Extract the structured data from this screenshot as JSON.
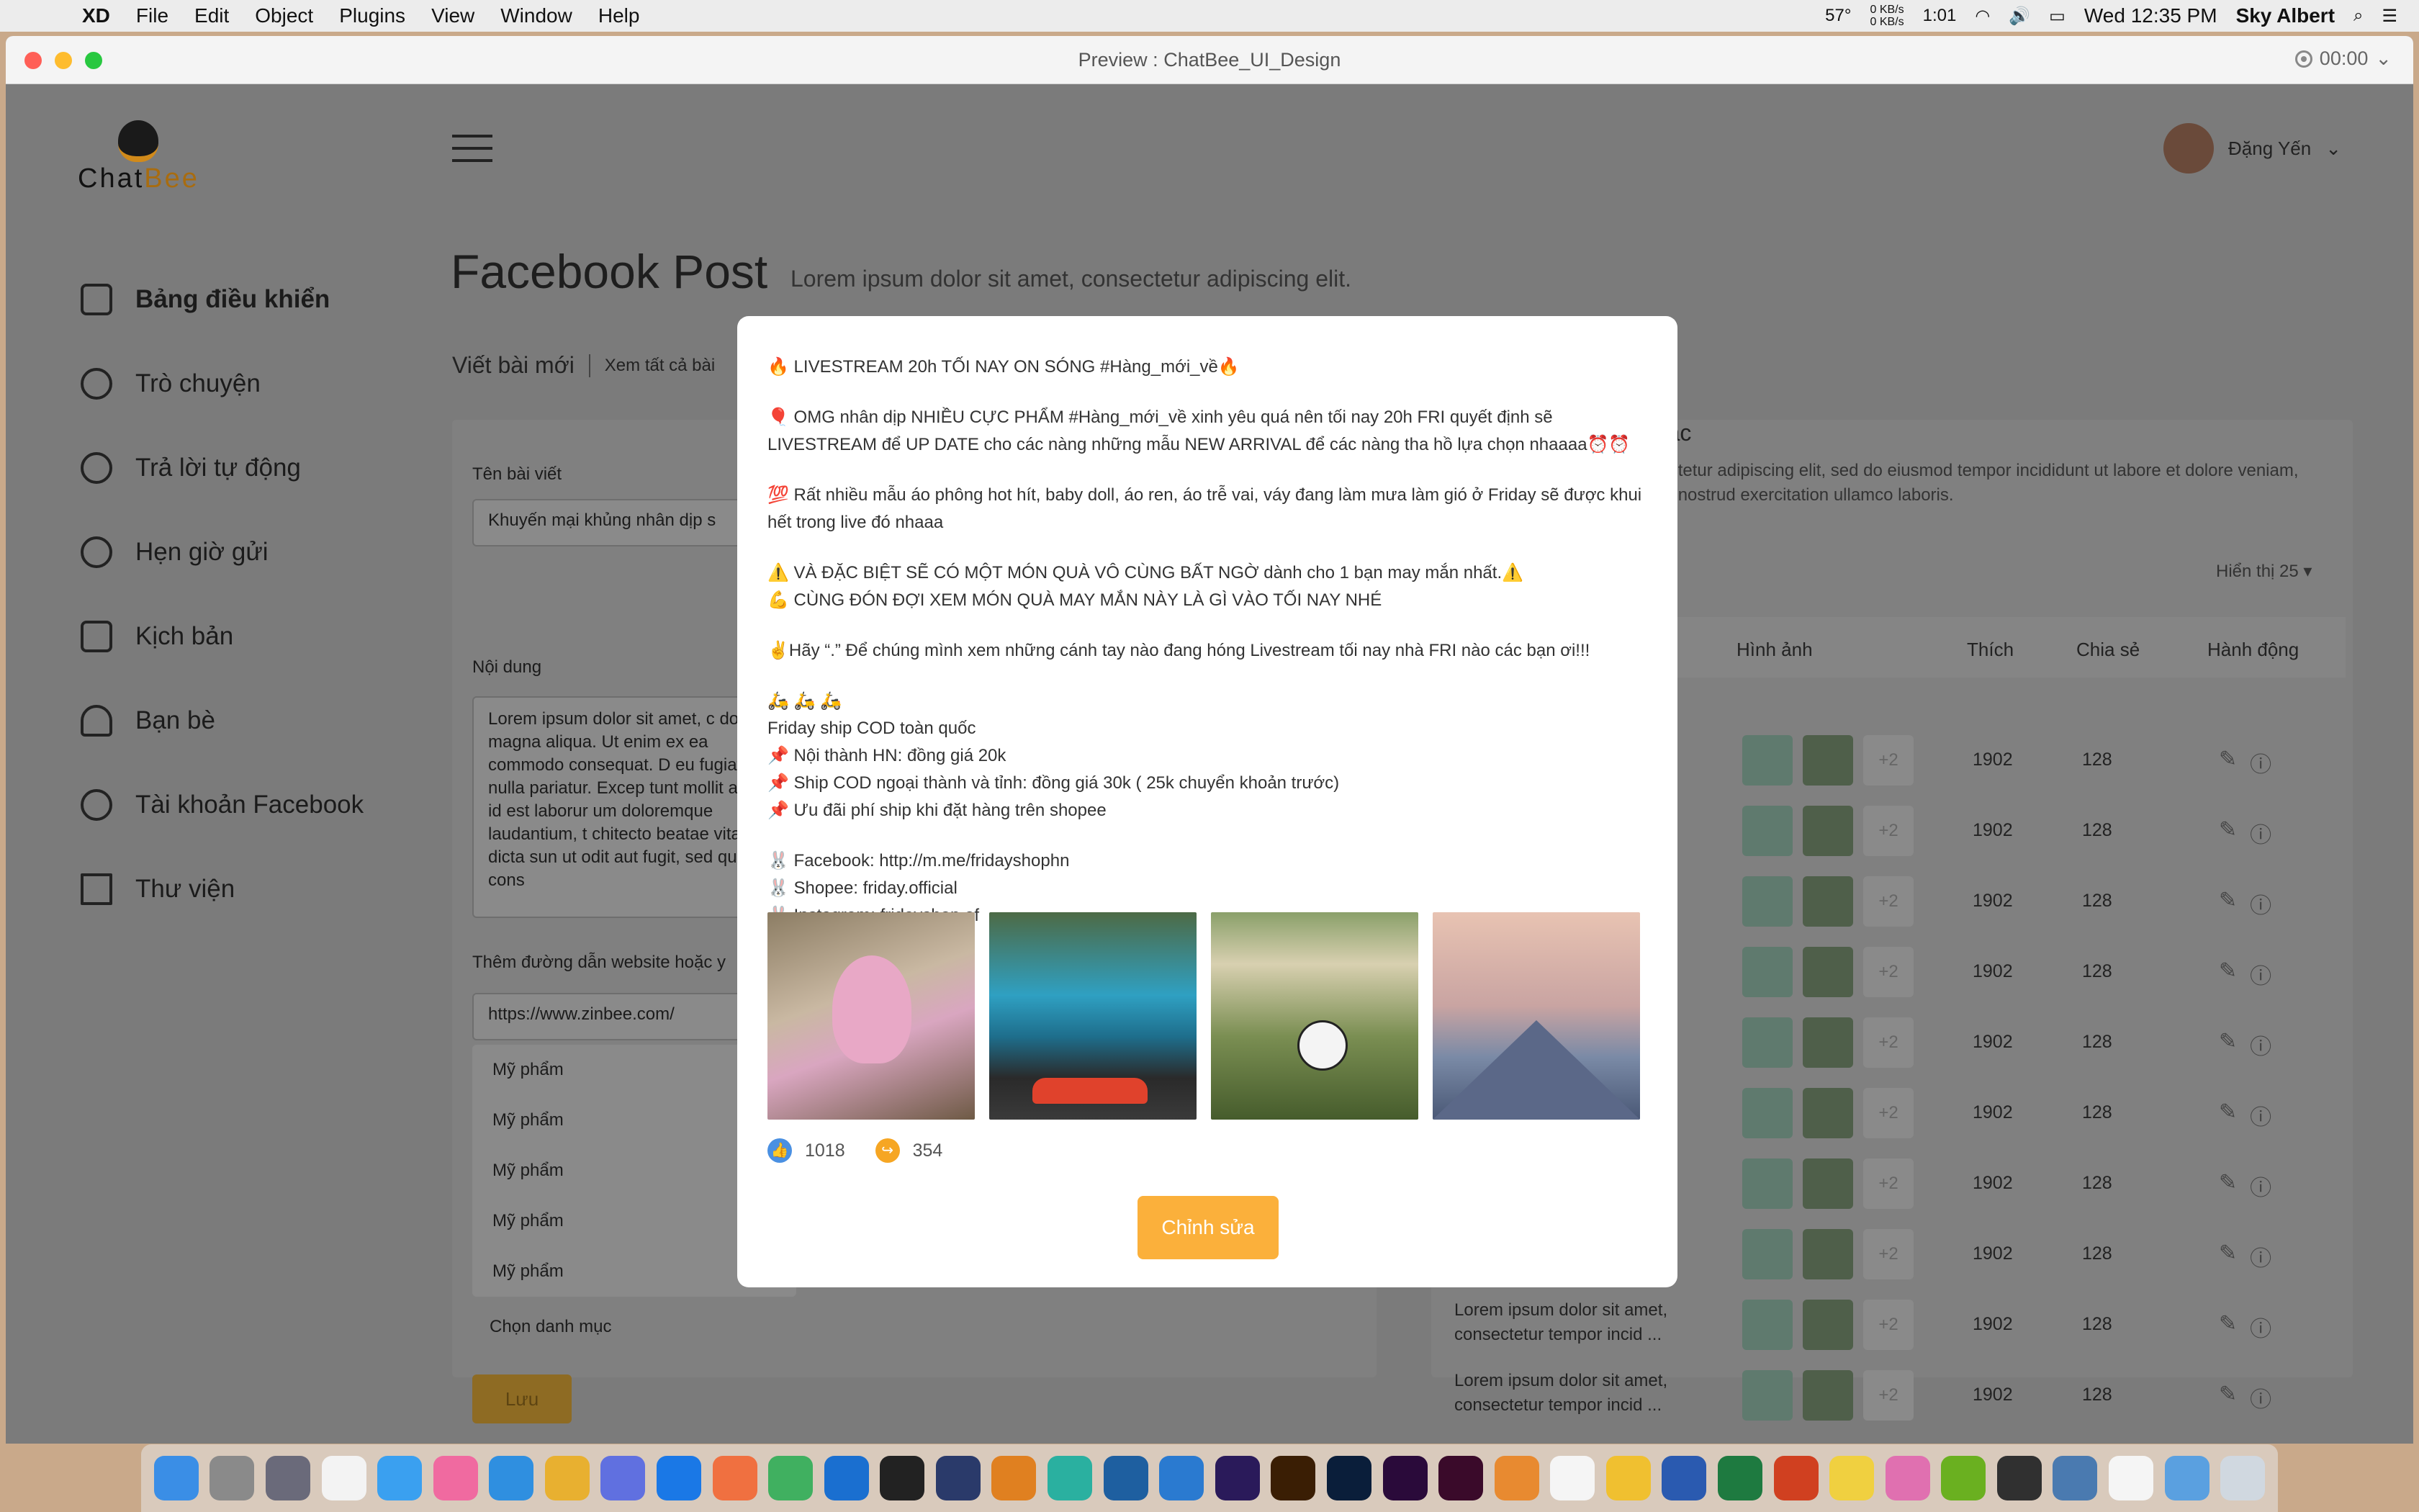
{
  "menubar": {
    "app": "XD",
    "items": [
      "File",
      "Edit",
      "Object",
      "Plugins",
      "View",
      "Window",
      "Help"
    ],
    "temperature": "57°",
    "net_up": "0 KB/s",
    "net_down": "0 KB/s",
    "battery_time": "1:01",
    "clock": "Wed 12:35 PM",
    "user": "Sky Albert"
  },
  "window": {
    "title": "Preview : ChatBee_UI_Design",
    "timer": "00:00"
  },
  "app": {
    "logo": {
      "chat": "Chat",
      "bee": "Bee"
    },
    "sidebar": [
      {
        "label": "Bảng điều khiển",
        "icon": "home-icon"
      },
      {
        "label": "Trò chuyện",
        "icon": "chat-icon"
      },
      {
        "label": "Trả lời tự động",
        "icon": "auto-reply-icon"
      },
      {
        "label": "Hẹn giờ gửi",
        "icon": "clock-icon"
      },
      {
        "label": "Kịch bản",
        "icon": "document-icon"
      },
      {
        "label": "Bạn bè",
        "icon": "friends-icon"
      },
      {
        "label": "Tài khoản Facebook",
        "icon": "account-icon"
      },
      {
        "label": "Thư viện",
        "icon": "library-icon"
      }
    ],
    "user_name": "Đặng Yến",
    "page_title": "Facebook Post",
    "page_subtitle": "Lorem ipsum dolor sit amet, consectetur adipiscing elit.",
    "tabs": {
      "new_post": "Viết bài mới",
      "view_all": "Xem tất cả bài"
    },
    "form": {
      "title_label": "Tên bài viết",
      "title_value": "Khuyến mại khủng nhân dịp s",
      "content_label": "Nội dung",
      "content_value": "Lorem ipsum dolor sit amet, c dolore magna aliqua. Ut enim ex ea commodo consequat. D eu fugiat nulla pariatur. Excep tunt mollit anim id est laborur um doloremque laudantium, t chitecto beatae vitae dicta sun ut odit aut fugit, sed quia cons",
      "link_label": "Thêm đường dẫn website hoặc y",
      "link_value": "https://www.zinbee.com/",
      "categories": [
        "Mỹ phẩm",
        "Mỹ phẩm",
        "Mỹ phẩm",
        "Mỹ phẩm",
        "Mỹ phẩm"
      ],
      "category_placeholder": "Chọn danh mục",
      "save_label": "Lưu"
    },
    "list_panel": {
      "title": "g tác",
      "description": "nsectetur adipiscing elit, sed do eiusmod tempor incididunt ut labore et dolore veniam, quis nostrud exercitation ullamco laboris.",
      "show_label": "Hiển thị 25",
      "headers": {
        "images": "Hình ảnh",
        "likes": "Thích",
        "shares": "Chia sẻ",
        "actions": "Hành động"
      },
      "rows": [
        {
          "caption": "",
          "more": "+2",
          "likes": "1902",
          "shares": "128"
        },
        {
          "caption": "",
          "more": "+2",
          "likes": "1902",
          "shares": "128"
        },
        {
          "caption": "",
          "more": "+2",
          "likes": "1902",
          "shares": "128"
        },
        {
          "caption": "",
          "more": "+2",
          "likes": "1902",
          "shares": "128"
        },
        {
          "caption": "",
          "more": "+2",
          "likes": "1902",
          "shares": "128"
        },
        {
          "caption": "",
          "more": "+2",
          "likes": "1902",
          "shares": "128"
        },
        {
          "caption": "",
          "more": "+2",
          "likes": "1902",
          "shares": "128"
        },
        {
          "caption": "",
          "more": "+2",
          "likes": "1902",
          "shares": "128"
        },
        {
          "caption": "Lorem ipsum dolor sit amet, consectetur tempor incid ...",
          "more": "+2",
          "likes": "1902",
          "shares": "128"
        },
        {
          "caption": "Lorem ipsum dolor sit amet, consectetur tempor incid ...",
          "more": "+2",
          "likes": "1902",
          "shares": "128"
        }
      ]
    }
  },
  "modal": {
    "lines": [
      "🔥 LIVESTREAM 20h TỐI NAY ON SÓNG #Hàng_mới_về🔥",
      "",
      "🎈 OMG nhân dịp NHIỀU CỰC PHẨM #Hàng_mới_về xinh yêu quá nên tối nay 20h FRI quyết định sẽ LIVESTREAM để UP DATE cho các nàng những mẫu NEW ARRIVAL để các nàng tha hồ lựa chọn nhaaaa⏰⏰",
      "",
      "💯 Rất nhiều mẫu áo phông hot hít, baby doll, áo ren, áo trễ vai, váy đang làm mưa làm gió ở Friday sẽ được khui hết trong live đó nhaaa",
      "",
      "⚠️ VÀ ĐẶC BIỆT SẼ CÓ MỘT MÓN QUÀ VÔ CÙNG BẤT NGỜ dành cho 1 bạn may mắn nhất.⚠️",
      "💪 CÙNG ĐÓN ĐỢI XEM MÓN QUÀ MAY MẮN NÀY LÀ GÌ VÀO TỐI NAY NHÉ",
      "",
      "✌Hãy “.” Để chúng mình xem những cánh tay nào đang hóng Livestream tối nay nhà FRI nào các bạn ơi!!!",
      "",
      "🛵 🛵 🛵",
      "Friday ship COD toàn quốc",
      "📌  Nội thành HN: đồng giá 20k",
      "📌  Ship COD ngoại thành và tỉnh: đồng giá 30k ( 25k chuyển khoản trước)",
      "📌  Ưu đãi phí ship khi đặt hàng trên shopee",
      "",
      "🐰 Facebook: http://m.me/fridayshophn",
      "🐰 Shopee: friday.official",
      "🐰 Instagram: fridayshop.of"
    ],
    "likes": "1018",
    "shares": "354",
    "edit_label": "Chỉnh sửa"
  }
}
